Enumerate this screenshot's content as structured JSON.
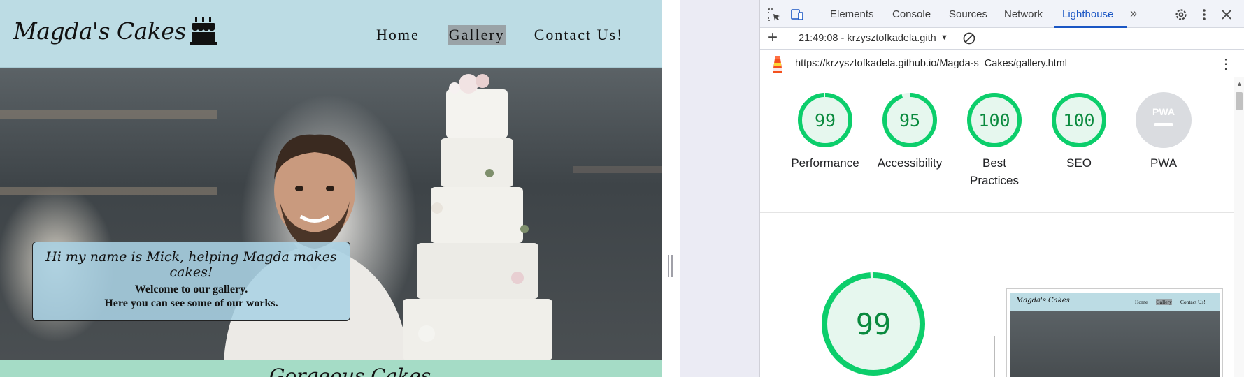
{
  "site": {
    "logo_text": "Magda's Cakes",
    "nav": [
      {
        "label": "Home"
      },
      {
        "label": "Gallery"
      },
      {
        "label": "Contact Us!"
      }
    ],
    "hero": {
      "title": "Hi my name is Mick, helping Magda makes cakes!",
      "line1": "Welcome to our gallery.",
      "line2": "Here you can see some of our works."
    },
    "bottom_heading": "Gorgeous Cakes"
  },
  "devtools": {
    "tabs": [
      {
        "label": "Elements"
      },
      {
        "label": "Console"
      },
      {
        "label": "Sources"
      },
      {
        "label": "Network"
      },
      {
        "label": "Lighthouse"
      }
    ],
    "active_tab": "Lighthouse",
    "report_label": "21:49:08 - krzysztofkadela.gith",
    "url": "https://krzysztofkadela.github.io/Magda-s_Cakes/gallery.html",
    "scores": [
      {
        "label": "Performance",
        "value": "99",
        "fraction": 0.99
      },
      {
        "label": "Accessibility",
        "value": "95",
        "fraction": 0.95
      },
      {
        "label": "Best Practices",
        "value": "100",
        "fraction": 1.0
      },
      {
        "label": "SEO",
        "value": "100",
        "fraction": 1.0
      },
      {
        "label": "PWA",
        "value": "PWA",
        "fraction": null
      }
    ],
    "main_score": {
      "value": "99",
      "fraction": 0.99
    },
    "preview": {
      "logo_text": "Magda's Cakes",
      "nav": [
        "Home",
        "Gallery",
        "Contact Us!"
      ]
    }
  },
  "colors": {
    "header_bg": "#bcdce4",
    "nav_active_bg": "#9aa3a7",
    "hero_box_bg": "#aad2e4",
    "footer_band": "#a5dcc6",
    "score_green": "#0cce6b",
    "score_green_fill": "#e6f7ee",
    "pwa_grey": "#dadce0",
    "devtools_accent": "#1a56c4"
  },
  "icons": [
    "cake-icon",
    "inspect-element-icon",
    "device-toggle-icon",
    "more-tabs-icon",
    "settings-gear-icon",
    "kebab-menu-icon",
    "close-icon",
    "add-icon",
    "clear-icon",
    "lighthouse-icon"
  ]
}
